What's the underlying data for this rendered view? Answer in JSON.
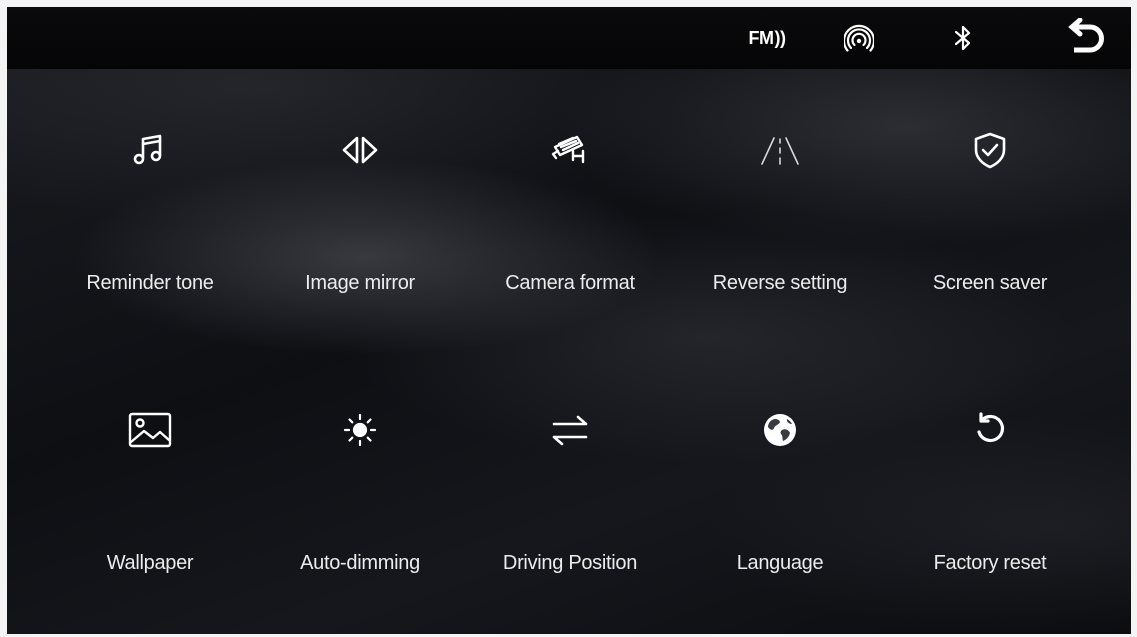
{
  "status_bar": {
    "fm_label": "FM",
    "fm_waves": "))",
    "icons": [
      "fm-radio-icon",
      "wireless-hotspot-icon",
      "bluetooth-icon",
      "back-icon"
    ]
  },
  "settings": {
    "items": [
      {
        "label": "Reminder tone",
        "icon": "music-note-icon"
      },
      {
        "label": "Image mirror",
        "icon": "mirror-arrows-icon"
      },
      {
        "label": "Camera format",
        "icon": "security-camera-icon"
      },
      {
        "label": "Reverse setting",
        "icon": "road-lanes-icon"
      },
      {
        "label": "Screen saver",
        "icon": "shield-check-icon"
      },
      {
        "label": "Wallpaper",
        "icon": "image-icon"
      },
      {
        "label": "Auto-dimming",
        "icon": "brightness-icon"
      },
      {
        "label": "Driving Position",
        "icon": "swap-arrows-icon"
      },
      {
        "label": "Language",
        "icon": "globe-icon"
      },
      {
        "label": "Factory reset",
        "icon": "reset-icon"
      }
    ]
  },
  "colors": {
    "background": "#111216",
    "status_bar": "#060607",
    "foreground": "#ffffff"
  }
}
